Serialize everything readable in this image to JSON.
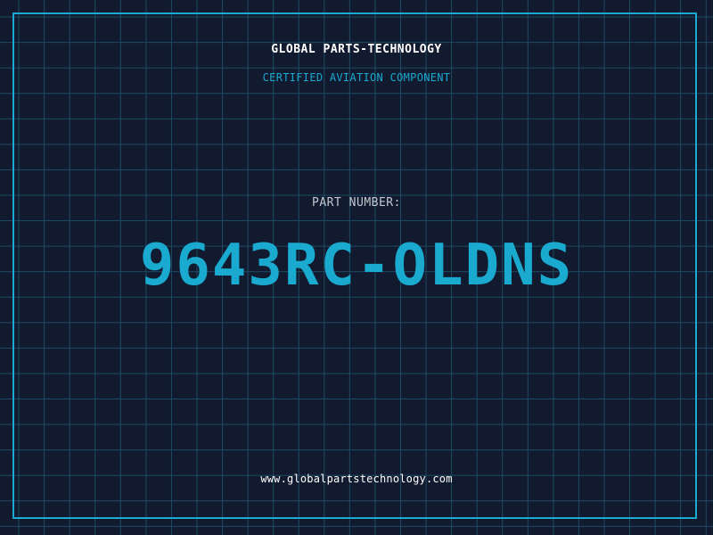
{
  "header": {
    "company": "GLOBAL PARTS-TECHNOLOGY",
    "subtitle": "CERTIFIED AVIATION COMPONENT"
  },
  "part": {
    "label": "PART NUMBER:",
    "number": "9643RC-OLDNS"
  },
  "footer": {
    "url": "www.globalpartstechnology.com"
  },
  "colors": {
    "background": "#111a2e",
    "grid": "#1d4b63",
    "accent": "#1aa9cf",
    "text": "#ffffff",
    "muted": "#c3c8d0"
  }
}
